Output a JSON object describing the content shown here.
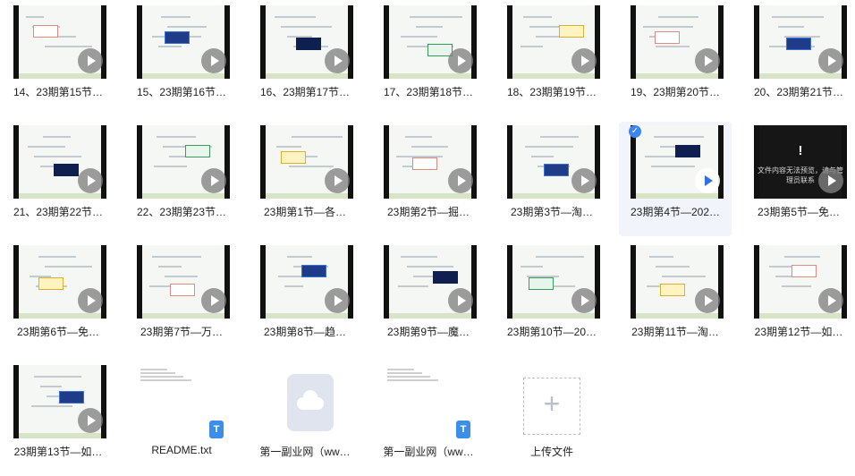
{
  "files": [
    {
      "name": "14、23期第15节…",
      "type": "video",
      "style": "light",
      "play": "gray"
    },
    {
      "name": "15、23期第16节…",
      "type": "video",
      "style": "light",
      "play": "gray"
    },
    {
      "name": "16、23期第17节…",
      "type": "video",
      "style": "light",
      "play": "gray"
    },
    {
      "name": "17、23期第18节…",
      "type": "video",
      "style": "light",
      "play": "gray"
    },
    {
      "name": "18、23期第19节…",
      "type": "video",
      "style": "light",
      "play": "gray"
    },
    {
      "name": "19、23期第20节…",
      "type": "video",
      "style": "light",
      "play": "gray"
    },
    {
      "name": "20、23期第21节…",
      "type": "video",
      "style": "light",
      "play": "gray"
    },
    {
      "name": "21、23期第22节…",
      "type": "video",
      "style": "light",
      "play": "gray"
    },
    {
      "name": "22、23期第23节…",
      "type": "video",
      "style": "light",
      "play": "gray"
    },
    {
      "name": "23期第1节—各…",
      "type": "video",
      "style": "light",
      "play": "gray"
    },
    {
      "name": "23期第2节—掘…",
      "type": "video",
      "style": "light",
      "play": "gray"
    },
    {
      "name": "23期第3节—淘…",
      "type": "video",
      "style": "light",
      "play": "gray"
    },
    {
      "name": "23期第4节—202…",
      "type": "video",
      "style": "light",
      "play": "blue",
      "selected": true
    },
    {
      "name": "23期第5节—免…",
      "type": "video",
      "style": "dark",
      "play": "gray",
      "warning": true
    },
    {
      "name": "23期第6节—免…",
      "type": "video",
      "style": "light",
      "play": "gray"
    },
    {
      "name": "23期第7节—万…",
      "type": "video",
      "style": "light",
      "play": "gray"
    },
    {
      "name": "23期第8节—趋…",
      "type": "video",
      "style": "light",
      "play": "gray"
    },
    {
      "name": "23期第9节—魔…",
      "type": "video",
      "style": "light",
      "play": "gray"
    },
    {
      "name": "23期第10节—20…",
      "type": "video",
      "style": "light",
      "play": "gray"
    },
    {
      "name": "23期第11节—淘…",
      "type": "video",
      "style": "light",
      "play": "gray"
    },
    {
      "name": "23期第12节—如…",
      "type": "video",
      "style": "light",
      "play": "gray"
    },
    {
      "name": "23期第13节—如…",
      "type": "video",
      "style": "light",
      "play": "gray"
    },
    {
      "name": "README.txt",
      "type": "txt"
    },
    {
      "name": "第一副业网（ww…",
      "type": "cloud"
    },
    {
      "name": "第一副业网（ww…",
      "type": "txt"
    },
    {
      "name": "上传文件",
      "type": "upload"
    }
  ],
  "warning_text": "文件内容无法预览，请与管理员联系",
  "txt_badge": "T",
  "upload_plus": "+",
  "selected_check": "✓",
  "colors": {
    "accent": "#3d86f2",
    "play_blue": "#2f6fe4",
    "selection_bg": "#f1f4fb"
  }
}
